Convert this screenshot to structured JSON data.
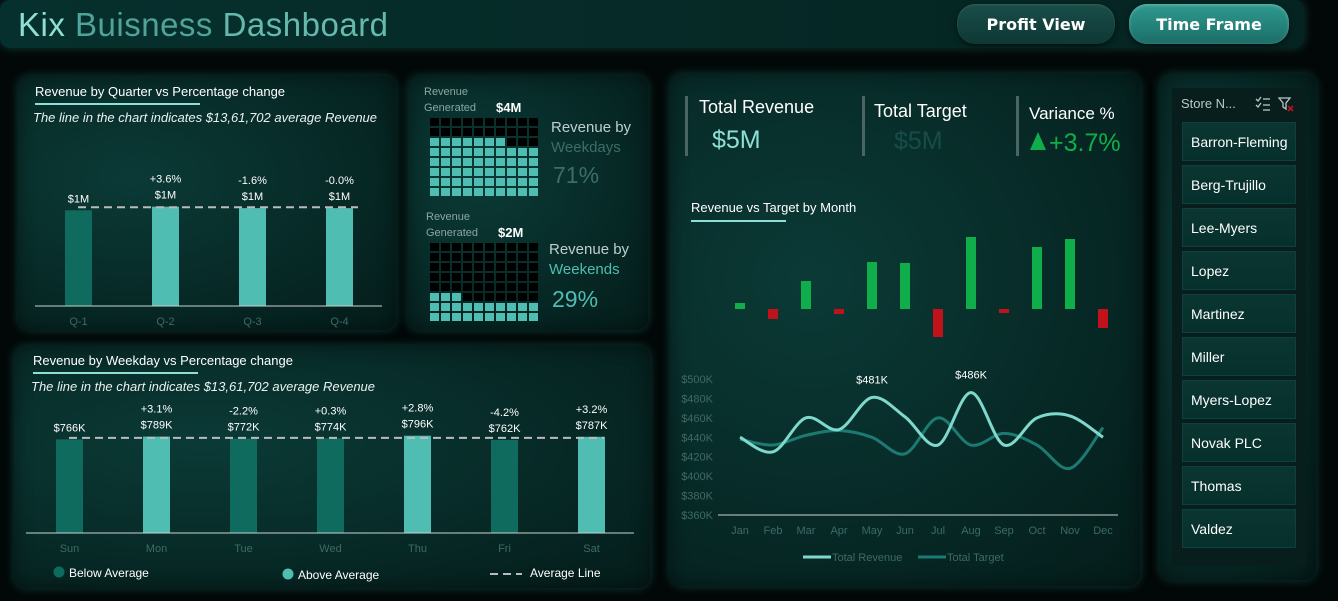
{
  "header": {
    "title_part1": "Kix ",
    "title_part2": "Buisness ",
    "title_part3": "Dashboard",
    "profit_view_label": "Profit View",
    "time_frame_label": "Time Frame"
  },
  "quarter_panel": {
    "title": "Revenue by Quarter vs Percentage change",
    "subtitle": "The line in the chart indicates $13,61,702 average Revenue"
  },
  "weekday_panel": {
    "title": "Revenue by Weekday vs Percentage change",
    "subtitle": "The line in the chart indicates $13,61,702 average Revenue",
    "legend": {
      "below": "Below Average",
      "above": "Above Average",
      "line": "Average Line"
    }
  },
  "waffle_panel": {
    "weekdays": {
      "label": "Revenue\nGenerated",
      "value": "$4M",
      "caption1": "Revenue by",
      "caption2": "Weekdays",
      "percent": "71%",
      "fraction": 0.71
    },
    "weekends": {
      "label": "Revenue\nGenerated",
      "value": "$2M",
      "caption1": "Revenue by",
      "caption2": "Weekends",
      "percent": "29%",
      "fraction": 0.29
    }
  },
  "kpi": {
    "total_revenue_label": "Total Revenue",
    "total_revenue_value": "$5M",
    "total_target_label": "Total Target",
    "total_target_value": "$5M",
    "variance_label": "Variance %",
    "variance_value": "+3.7%"
  },
  "month_panel": {
    "title": "Revenue vs Target by Month",
    "legend_revenue": "Total Revenue",
    "legend_target": "Total Target"
  },
  "slicer": {
    "title": "Store N...",
    "items": [
      "Barron-Fleming",
      "Berg-Trujillo",
      "Lee-Myers",
      "Lopez",
      "Martinez",
      "Miller",
      "Myers-Lopez",
      "Novak PLC",
      "Thomas",
      "Valdez"
    ]
  },
  "colors": {
    "below_avg": "#0e6b5e",
    "above_avg": "#4fbdb1",
    "positive": "#0fae4a",
    "negative": "#c0121b",
    "revenue_line": "#7fd8cc",
    "target_line": "#1c7a72"
  },
  "chart_data": [
    {
      "type": "bar",
      "id": "quarter",
      "categories": [
        "Q-1",
        "Q-2",
        "Q-3",
        "Q-4"
      ],
      "values": [
        1.32,
        1.37,
        1.35,
        1.35
      ],
      "value_labels": [
        "$1M",
        "$1M",
        "$1M",
        "$1M"
      ],
      "pct_labels": [
        "",
        "+3.6%",
        "-1.6%",
        "-0.0%"
      ],
      "below_average": [
        true,
        false,
        false,
        false
      ],
      "average": 1.361702,
      "ylim": [
        0,
        1.6
      ]
    },
    {
      "type": "bar",
      "id": "weekday",
      "categories": [
        "Sun",
        "Mon",
        "Tue",
        "Wed",
        "Thu",
        "Fri",
        "Sat"
      ],
      "values": [
        766,
        789,
        772,
        774,
        796,
        762,
        787
      ],
      "value_labels": [
        "$766K",
        "$789K",
        "$772K",
        "$774K",
        "$796K",
        "$762K",
        "$787K"
      ],
      "pct_labels": [
        "",
        "+3.1%",
        "-2.2%",
        "+0.3%",
        "+2.8%",
        "-4.2%",
        "+3.2%"
      ],
      "below_average": [
        true,
        false,
        true,
        true,
        false,
        true,
        false
      ],
      "average": 778,
      "ylim": [
        0,
        900
      ]
    },
    {
      "type": "bar",
      "id": "variance",
      "categories": [
        "Jan",
        "Feb",
        "Mar",
        "Apr",
        "May",
        "Jun",
        "Jul",
        "Aug",
        "Sep",
        "Oct",
        "Nov",
        "Dec"
      ],
      "values": [
        6,
        -10,
        28,
        -5,
        47,
        46,
        -28,
        72,
        -4,
        62,
        70,
        -19
      ]
    },
    {
      "type": "line",
      "id": "monthly",
      "categories": [
        "Jan",
        "Feb",
        "Mar",
        "Apr",
        "May",
        "Jun",
        "Jul",
        "Aug",
        "Sep",
        "Oct",
        "Nov",
        "Dec"
      ],
      "series": [
        {
          "name": "Total Revenue",
          "values": [
            440,
            425,
            460,
            448,
            481,
            461,
            432,
            486,
            432,
            460,
            462,
            440
          ]
        },
        {
          "name": "Total Target",
          "values": [
            438,
            432,
            442,
            447,
            440,
            423,
            460,
            432,
            444,
            432,
            408,
            450
          ]
        }
      ],
      "point_labels": [
        {
          "index": 4,
          "text": "$481K"
        },
        {
          "index": 7,
          "text": "$486K"
        }
      ],
      "yticks": [
        "$360K",
        "$380K",
        "$400K",
        "$420K",
        "$440K",
        "$460K",
        "$480K",
        "$500K"
      ],
      "ylim": [
        360,
        500
      ]
    }
  ]
}
